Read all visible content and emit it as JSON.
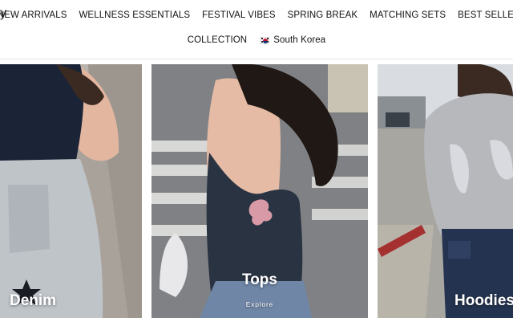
{
  "header": {
    "logo_fragment": "y",
    "nav_row1": [
      "NEW ARRIVALS",
      "WELLNESS ESSENTIALS",
      "FESTIVAL VIBES",
      "SPRING BREAK",
      "MATCHING SETS",
      "BEST SELLERS"
    ],
    "nav_row2_collection": "COLLECTION",
    "country_selector": {
      "label": "South Korea",
      "flag_icon": "south-korea-flag-icon"
    }
  },
  "categories": [
    {
      "title": "Denim",
      "cta": ""
    },
    {
      "title": "Tops",
      "cta": "Explore"
    },
    {
      "title": "Hoodies",
      "cta": ""
    }
  ],
  "colors": {
    "nav_background": "#ffffff",
    "nav_text": "#111111",
    "tile_label": "#ffffff"
  }
}
